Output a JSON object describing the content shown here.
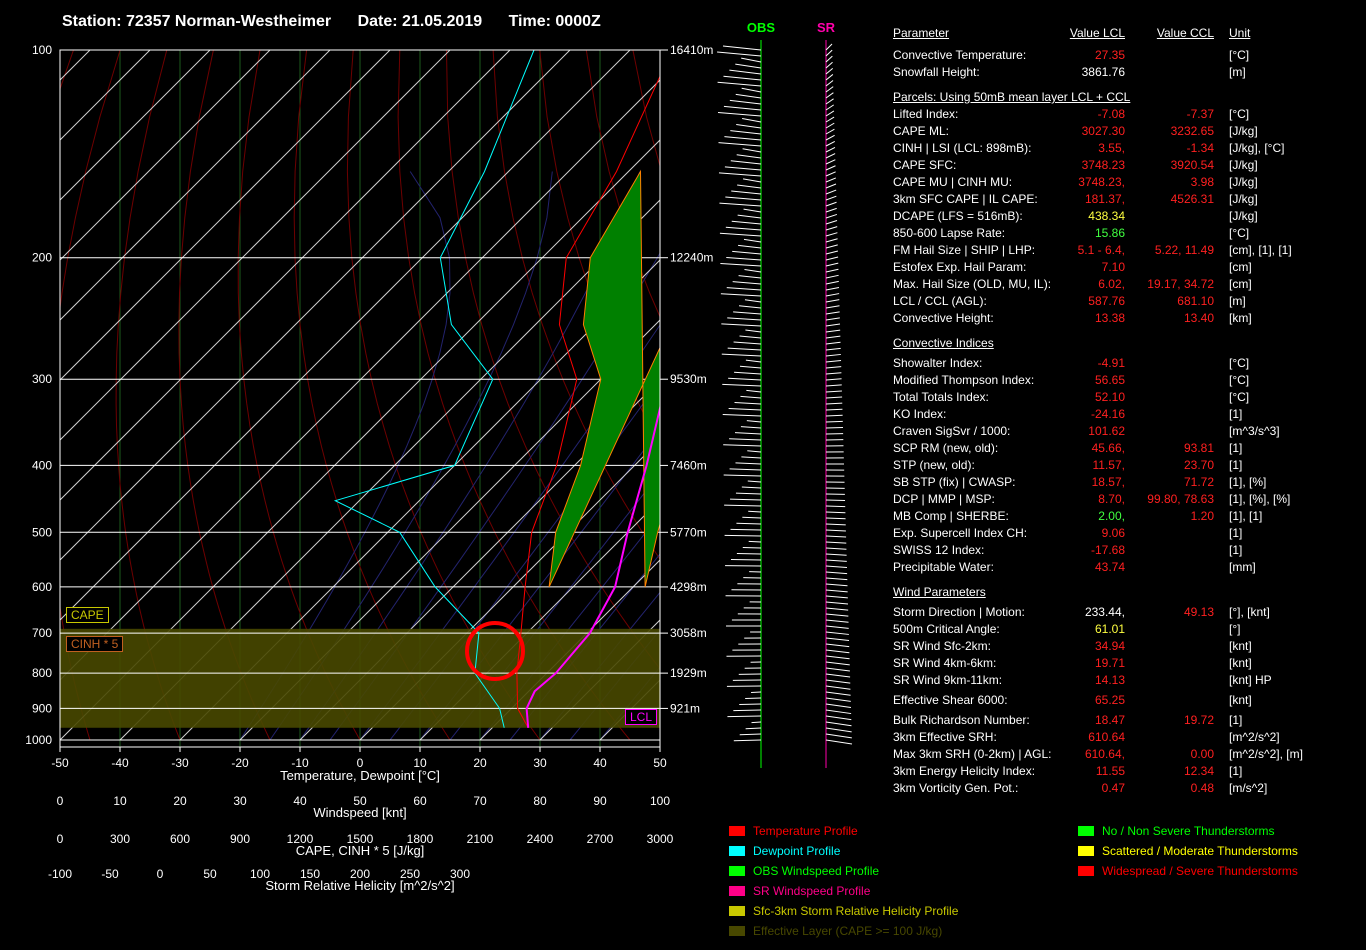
{
  "header": {
    "station": "Station: 72357 Norman-Westheimer",
    "date": "Date: 21.05.2019",
    "time": "Time: 0000Z"
  },
  "hodo_labels": {
    "obs": "OBS",
    "sr": "SR"
  },
  "boxes": {
    "cape": "CAPE",
    "cinh": "CINH * 5",
    "lcl": "LCL"
  },
  "colors": {
    "temp": "#ff0000",
    "dew": "#00ffff",
    "obs": "#00ff00",
    "sr": "#ff00aa",
    "srh": "#c8c800",
    "eff": "#484800",
    "cape_fill": "#008000"
  },
  "chart_data": {
    "type": "line",
    "title": "",
    "xlabel": "Temperature, Dewpoint [°C]",
    "x_range": [
      -50,
      50
    ],
    "x_ticks": [
      "-50",
      "-40",
      "-30",
      "-20",
      "-10",
      "0",
      "10",
      "20",
      "30",
      "40",
      "50"
    ],
    "pressure_ticks": [
      "100",
      "200",
      "300",
      "400",
      "500",
      "600",
      "700",
      "800",
      "900",
      "1000"
    ],
    "height_labels": [
      {
        "p": 100,
        "label": "16410m"
      },
      {
        "p": 200,
        "label": "12240m"
      },
      {
        "p": 300,
        "label": "9530m"
      },
      {
        "p": 400,
        "label": "7460m"
      },
      {
        "p": 500,
        "label": "5770m"
      },
      {
        "p": 600,
        "label": "4298m"
      },
      {
        "p": 700,
        "label": "3058m"
      },
      {
        "p": 800,
        "label": "1929m"
      },
      {
        "p": 900,
        "label": "921m"
      }
    ],
    "secondary_axes": [
      {
        "label": "Windspeed [knt]",
        "ticks": [
          "0",
          "10",
          "20",
          "30",
          "40",
          "50",
          "60",
          "70",
          "80",
          "90",
          "100"
        ]
      },
      {
        "label": "CAPE, CINH * 5 [J/kg]",
        "ticks": [
          "0",
          "300",
          "600",
          "900",
          "1200",
          "1500",
          "1800",
          "2100",
          "2400",
          "2700",
          "3000"
        ]
      },
      {
        "label": "Storm Relative Helicity [m^2/s^2]",
        "ticks": [
          "-100",
          "-50",
          "0",
          "50",
          "100",
          "150",
          "200",
          "250",
          "300"
        ]
      }
    ],
    "series": [
      {
        "name": "Temperature Profile",
        "points": [
          [
            100,
            -63
          ],
          [
            150,
            -52
          ],
          [
            200,
            -46
          ],
          [
            250,
            -36
          ],
          [
            300,
            -24
          ],
          [
            400,
            -13
          ],
          [
            500,
            -6
          ],
          [
            600,
            2
          ],
          [
            700,
            9
          ],
          [
            800,
            15
          ],
          [
            900,
            21
          ],
          [
            960,
            26
          ]
        ]
      },
      {
        "name": "Dewpoint Profile",
        "points": [
          [
            100,
            -86
          ],
          [
            150,
            -74
          ],
          [
            200,
            -67
          ],
          [
            250,
            -54
          ],
          [
            300,
            -38
          ],
          [
            400,
            -30
          ],
          [
            450,
            -44
          ],
          [
            500,
            -28
          ],
          [
            600,
            -13
          ],
          [
            700,
            2
          ],
          [
            800,
            8
          ],
          [
            900,
            18
          ],
          [
            960,
            22
          ]
        ]
      },
      {
        "name": "Parcel",
        "points": [
          [
            960,
            26
          ],
          [
            900,
            22.5
          ],
          [
            850,
            21
          ],
          [
            800,
            21.5
          ],
          [
            700,
            20.5
          ],
          [
            600,
            17
          ],
          [
            500,
            10
          ],
          [
            400,
            2
          ],
          [
            300,
            -9
          ],
          [
            200,
            -22
          ],
          [
            150,
            -28
          ],
          [
            100,
            -47
          ]
        ]
      }
    ]
  },
  "params": {
    "h1": [
      "Parameter",
      "Value LCL",
      "Value CCL",
      "Unit"
    ],
    "rows1": [
      [
        "Convective Temperature:",
        "27.35",
        "",
        "[°C]"
      ],
      [
        "Snowfall Height:",
        "3861.76",
        "",
        "[m]"
      ]
    ],
    "h2": "Parcels: Using 50mB mean layer LCL + CCL",
    "rows2": [
      [
        "Lifted Index:",
        "-7.08",
        "-7.37",
        "[°C]"
      ],
      [
        "CAPE ML:",
        "3027.30",
        "3232.65",
        "[J/kg]"
      ],
      [
        "CINH | LSI (LCL: 898mB):",
        "3.55,",
        "-1.34",
        "[J/kg], [°C]"
      ],
      [
        "CAPE SFC:",
        "3748.23",
        "3920.54",
        "[J/kg]"
      ],
      [
        "CAPE MU | CINH MU:",
        "3748.23,",
        "3.98",
        "[J/kg]"
      ],
      [
        "3km SFC CAPE | IL CAPE:",
        "181.37,",
        "4526.31",
        "[J/kg]"
      ],
      [
        "DCAPE (LFS = 516mB):",
        "438.34",
        "",
        "[J/kg]"
      ],
      [
        "850-600 Lapse Rate:",
        "15.86",
        "",
        "[°C]"
      ],
      [
        "FM Hail Size | SHIP | LHP:",
        "5.1 - 6.4,",
        "5.22,   11.49",
        "[cm], [1], [1]"
      ],
      [
        "Estofex Exp. Hail Param:",
        "7.10",
        "",
        "[cm]"
      ],
      [
        "Max. Hail Size (OLD, MU, IL):",
        "6.02,",
        "19.17,   34.72",
        "[cm]"
      ],
      [
        "LCL / CCL (AGL):",
        "587.76",
        "681.10",
        "[m]"
      ],
      [
        "Convective Height:",
        "13.38",
        "13.40",
        "[km]"
      ]
    ],
    "h3": "Convective Indices",
    "rows3": [
      [
        "Showalter Index:",
        "-4.91",
        "",
        "[°C]"
      ],
      [
        "Modified Thompson Index:",
        "56.65",
        "",
        "[°C]"
      ],
      [
        "Total Totals Index:",
        "52.10",
        "",
        "[°C]"
      ],
      [
        "KO Index:",
        "-24.16",
        "",
        "[1]"
      ],
      [
        "Craven SigSvr / 1000:",
        "101.62",
        "",
        "[m^3/s^3]"
      ],
      [
        "SCP RM (new, old):",
        "45.66,",
        "93.81",
        "[1]"
      ],
      [
        "STP (new, old):",
        "11.57,",
        "23.70",
        "[1]"
      ],
      [
        "SB STP (fix) | CWASP:",
        "18.57,",
        "71.72",
        "[1], [%]"
      ],
      [
        "DCP | MMP | MSP:",
        "8.70,",
        "99.80,   78.63",
        "[1], [%], [%]"
      ],
      [
        "MB Comp | SHERBE:",
        "2.00,",
        "1.20",
        "[1], [1]"
      ],
      [
        "Exp. Supercell Index CH:",
        "9.06",
        "",
        "[1]"
      ],
      [
        "SWISS 12 Index:",
        "-17.68",
        "",
        "[1]"
      ],
      [
        "Precipitable Water:",
        "43.74",
        "",
        "[mm]"
      ]
    ],
    "h4": "Wind Parameters",
    "rows4": [
      [
        "Storm Direction | Motion:",
        "233.44,",
        "49.13",
        "[°], [knt]"
      ],
      [
        "500m Critical Angle:",
        "61.01",
        "",
        "[°]"
      ],
      [
        "SR Wind Sfc-2km:",
        "34.94",
        "",
        "[knt]"
      ],
      [
        "SR Wind 4km-6km:",
        "19.71",
        "",
        "[knt]"
      ],
      [
        "SR Wind 9km-11km:",
        "14.13",
        "",
        "[knt] HP"
      ],
      [
        "Effective Shear 6000:",
        "65.25",
        "",
        "[knt]"
      ],
      [
        "Bulk Richardson Number:",
        "18.47",
        "19.72",
        "[1]"
      ],
      [
        "3km Effective SRH:",
        "610.64",
        "",
        "[m^2/s^2]"
      ],
      [
        "Max 3km SRH (0-2km) | AGL:",
        "610.64,",
        "0.00",
        "[m^2/s^2], [m]"
      ],
      [
        "3km Energy Helicity Index:",
        "11.55",
        "12.34",
        "[1]"
      ],
      [
        "3km Vorticity Gen. Pot.:",
        "0.47",
        "0.48",
        "[m/s^2]"
      ]
    ]
  },
  "legend_left": [
    {
      "label": "Temperature Profile",
      "color": "#ff0000"
    },
    {
      "label": "Dewpoint Profile",
      "color": "#00ffff"
    },
    {
      "label": "OBS Windspeed Profile",
      "color": "#00ff00"
    },
    {
      "label": "SR Windspeed Profile",
      "color": "#ff0088"
    },
    {
      "label": "Sfc-3km Storm Relative Helicity Profile",
      "color": "#c8c800"
    },
    {
      "label": "Effective Layer (CAPE >= 100 J/kg)",
      "color": "#484800"
    }
  ],
  "legend_right": [
    {
      "label": "No / Non Severe Thunderstorms",
      "color": "#00ff00"
    },
    {
      "label": "Scattered / Moderate Thunderstorms",
      "color": "#ffff00"
    },
    {
      "label": "Widespread / Severe Thunderstorms",
      "color": "#ff0000"
    }
  ]
}
